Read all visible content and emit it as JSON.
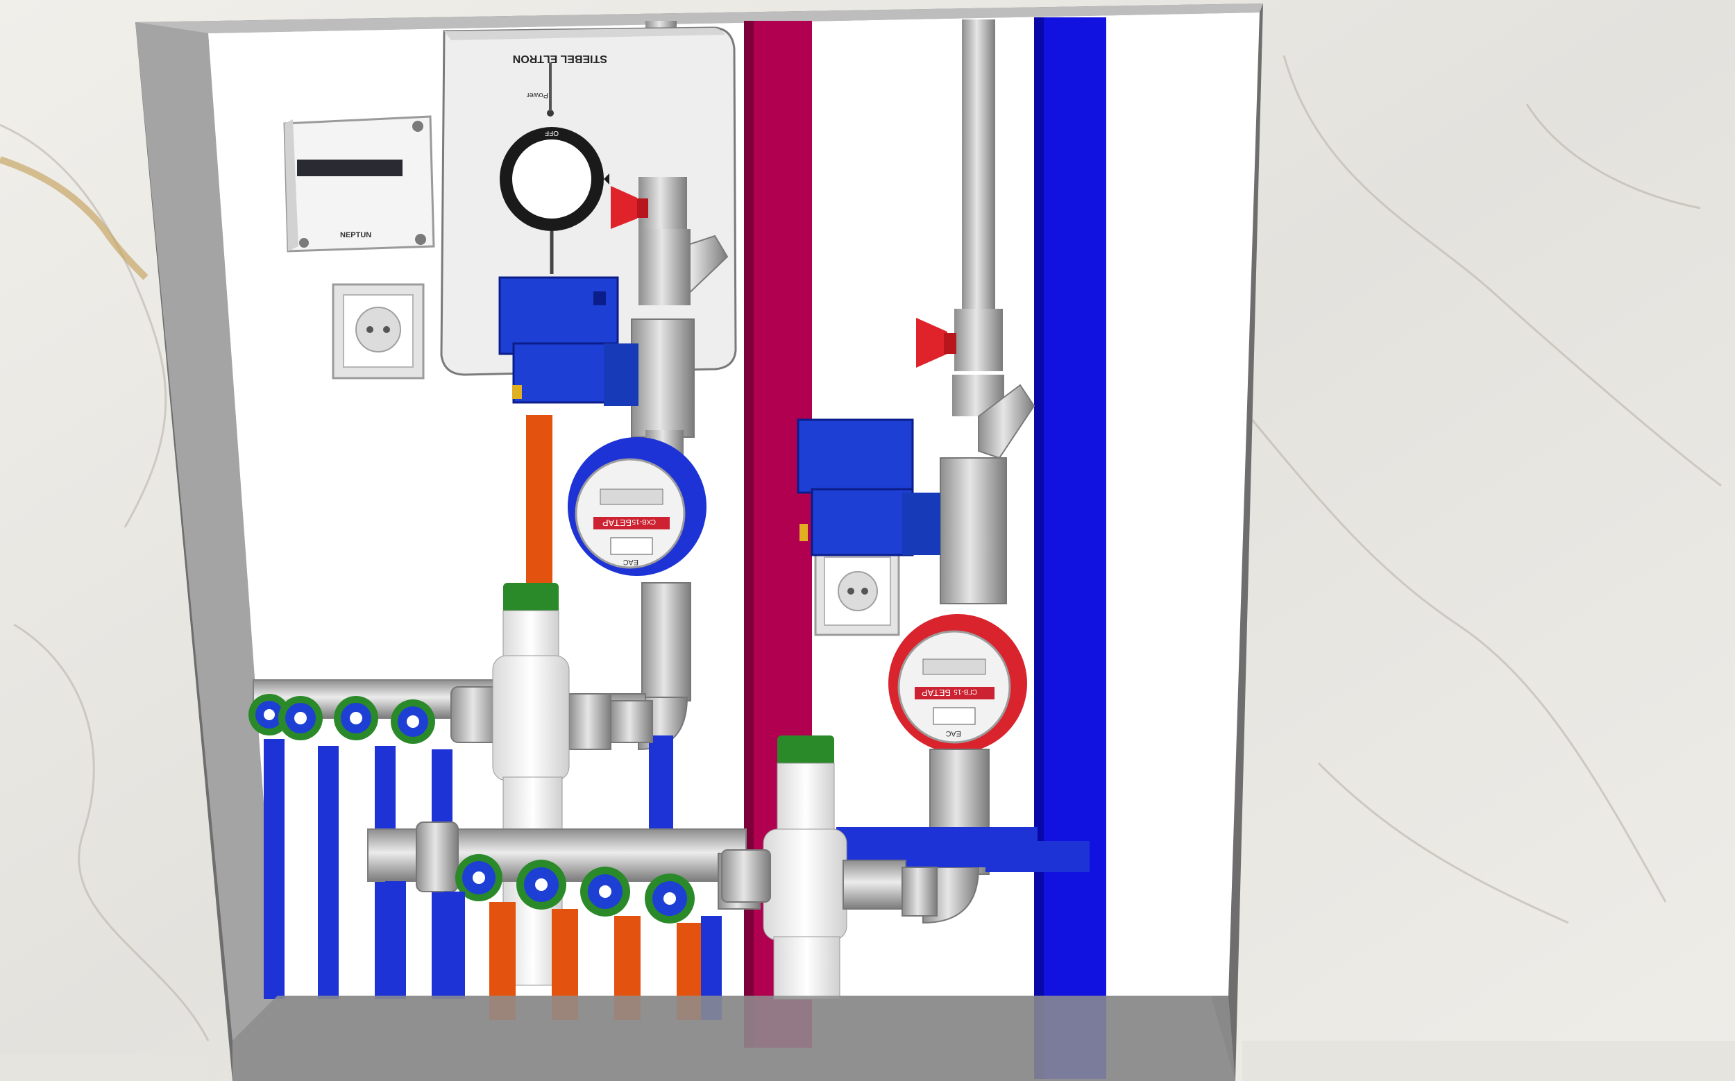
{
  "scene": {
    "panel_brand": "NEPTUN",
    "heater_brand": "STIEBEL ELTRON",
    "heater_power_label": "Power",
    "heater_knob_label": "OFF",
    "meter_hot_brand": "БЕТАР",
    "meter_hot_model": "СГВ-15",
    "meter_cold_brand": "БЕТАР",
    "meter_cold_model": "СХВ-15",
    "meter_mark": "ЕАС"
  },
  "colors": {
    "hot_pipe": "#e4520f",
    "cold_pipe": "#1d33d6",
    "riser_red": "#b0004f",
    "riser_blue": "#1212e0",
    "valve_body": "#1e3fd4",
    "valve_cap": "#2a8a2a",
    "handle_red": "#e0222a",
    "frame_grey": "#8a8a8a"
  }
}
